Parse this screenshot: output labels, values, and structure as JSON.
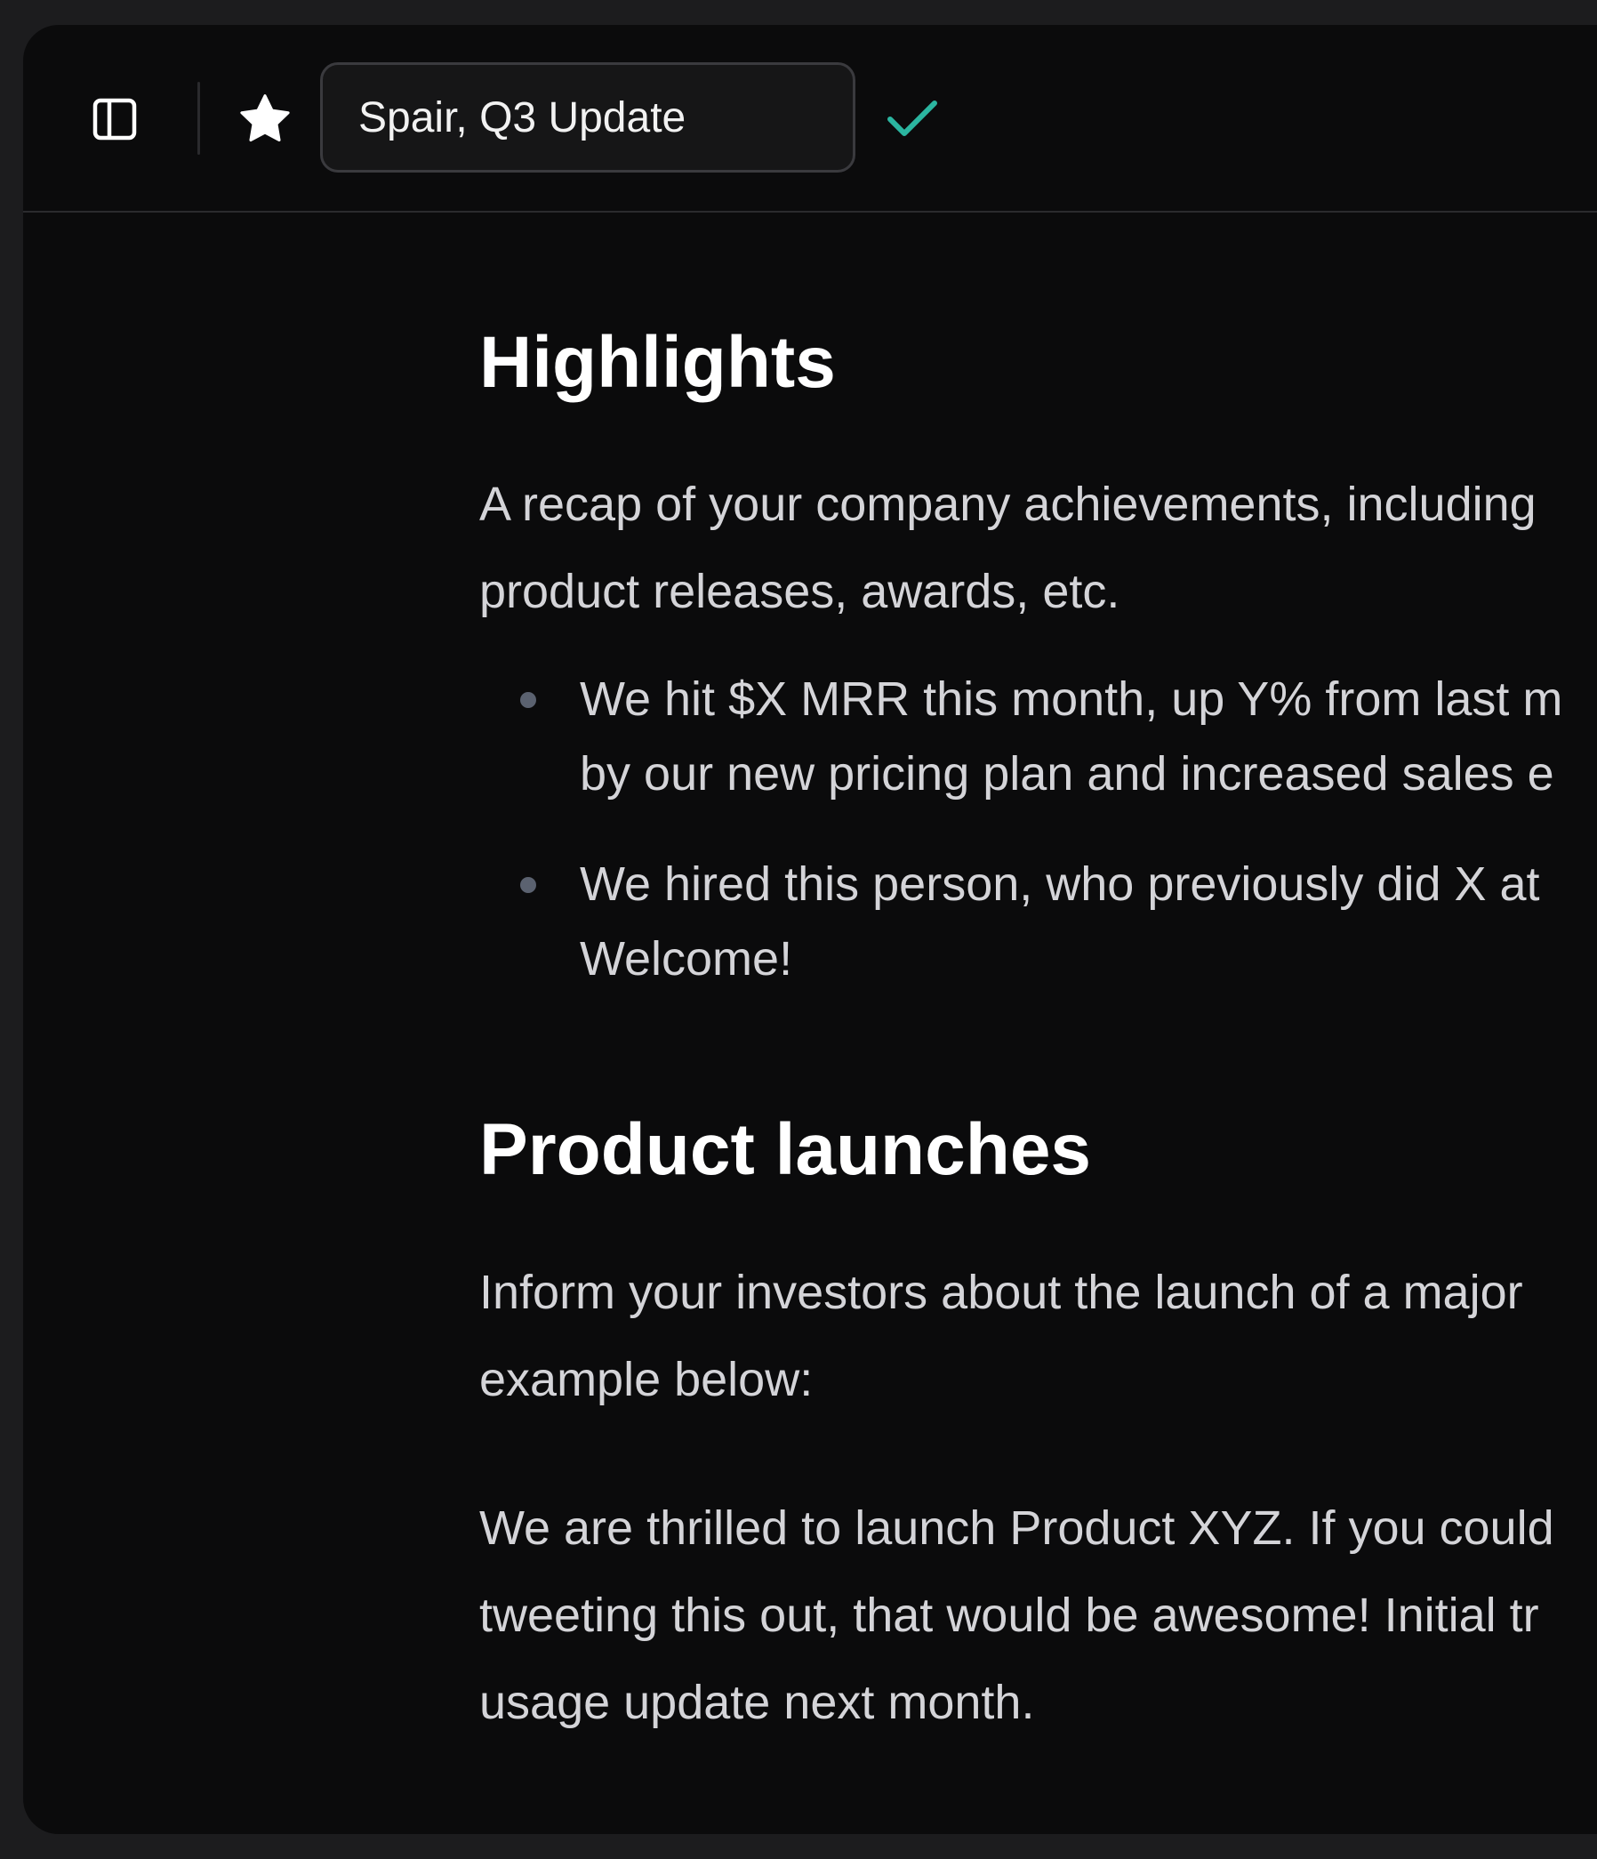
{
  "toolbar": {
    "sidebar_toggle_icon": "sidebar-panel-icon",
    "star_icon": "star-icon",
    "title_value": "Spair, Q3 Update",
    "check_icon": "checkmark-icon",
    "check_color": "#2bb5a0"
  },
  "document": {
    "highlights": {
      "heading": "Highlights",
      "intro_line1": "A recap of your company achievements, including",
      "intro_line2": "product releases, awards, etc.",
      "bullets": [
        {
          "line1": "We hit $X MRR this month, up Y% from last m",
          "line2": "by our new pricing plan and increased sales e"
        },
        {
          "line1": "We hired this person, who previously did X at",
          "line2": "Welcome!"
        }
      ]
    },
    "product_launches": {
      "heading": "Product launches",
      "intro_line1": "Inform your investors about the launch of a major",
      "intro_line2": "example below:",
      "body_line1": "We are thrilled to launch Product XYZ. If you could",
      "body_line2": "tweeting this out, that would be awesome! Initial tr",
      "body_line3": "usage update next month."
    }
  }
}
